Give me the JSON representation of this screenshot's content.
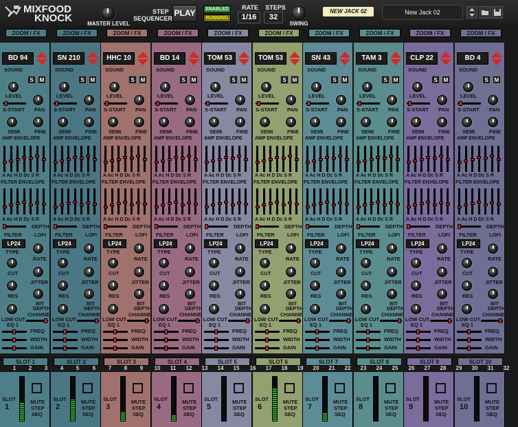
{
  "app": {
    "brand_line1": "MIXFOOD",
    "brand_line2": "KNOCK",
    "master_label": "MASTER LEVEL"
  },
  "transport": {
    "step_label": "STEP",
    "sequencer_label": "SEQUENCER",
    "play_label": "PLAY",
    "enabled_label": "ENABLED",
    "running_label": "RUNNING",
    "rate_label": "RATE",
    "rate_value": "1/16",
    "steps_label": "STEPS",
    "steps_value": "32",
    "swing_label": "SWING"
  },
  "preset": {
    "badge": "NEW JACK 02",
    "name": "New Jack 02"
  },
  "labels": {
    "zoom": "ZOOM / FX",
    "sound": "SOUND",
    "s": "S",
    "m": "M",
    "level": "LEVEL",
    "sstart": "S-START",
    "pan": "PAN",
    "semi": "SEMI",
    "fine": "FINE",
    "amp_env": "AMP ENVELOPE",
    "filter_env": "FILTER ENVELOPE",
    "env_keys": "A Ac H D Dc S R",
    "depth": "DEPTH",
    "filter": "FILTER",
    "lofi": "LOFI",
    "type": "TYPE",
    "rate": "RATE",
    "cut": "CUT",
    "jitter": "JITTER",
    "res": "RES",
    "bit": "BIT",
    "depth2": "DEPTH",
    "channel": "CHANNEL",
    "low_cut": "LOW CUT",
    "eq1": "EQ 1",
    "freq": "FREQ",
    "width": "WIDTH",
    "gain": "GAIN",
    "mute": "MUTE",
    "step": "STEP",
    "seq": "SEQ",
    "slot": "SLOT"
  },
  "channels": [
    {
      "sound": "BD 94",
      "filter": "LP24",
      "slot_label": "SLOT 1",
      "slot_num": "1",
      "color": "#4e7f88"
    },
    {
      "sound": "SN 210",
      "filter": "LP24",
      "slot_label": "SLOT 2",
      "slot_num": "2",
      "color": "#4b7684"
    },
    {
      "sound": "HHC 10",
      "filter": "LP24",
      "slot_label": "SLOT 3",
      "slot_num": "3",
      "color": "#a1726d"
    },
    {
      "sound": "BD 14",
      "filter": "LP24",
      "slot_label": "SLOT 4",
      "slot_num": "4",
      "color": "#9a6a82"
    },
    {
      "sound": "TOM 53",
      "filter": "LP24",
      "slot_label": "SLOT 5",
      "slot_num": "5",
      "color": "#8788a2"
    },
    {
      "sound": "TOM 53",
      "filter": "LP24",
      "slot_label": "SLOT 6",
      "slot_num": "6",
      "color": "#93a070"
    },
    {
      "sound": "SN 43",
      "filter": "LP24",
      "slot_label": "SLOT 7",
      "slot_num": "7",
      "color": "#5e8c96"
    },
    {
      "sound": "TAM 3",
      "filter": "LP24",
      "slot_label": "SLOT 8",
      "slot_num": "8",
      "color": "#5b8d8e"
    },
    {
      "sound": "CLP 22",
      "filter": "LP24",
      "slot_label": "SLOT 9",
      "slot_num": "9",
      "color": "#7a6d9c"
    },
    {
      "sound": "BD 4",
      "filter": "LP24",
      "slot_label": "SLOT 10",
      "slot_num": "10",
      "color": "#6f6e93"
    }
  ],
  "step_numbers": [
    "1",
    "2",
    "3",
    "4",
    "5",
    "6",
    "7",
    "8",
    "9",
    "10",
    "11",
    "12",
    "13",
    "14",
    "15",
    "16",
    "17",
    "18",
    "19",
    "20",
    "21",
    "22",
    "23",
    "24",
    "25",
    "26",
    "27",
    "28",
    "29",
    "30",
    "31",
    "32"
  ],
  "meter_levels": [
    0.42,
    0.48,
    0.2,
    0.12,
    0,
    0.75,
    0.18,
    0,
    0,
    0
  ]
}
